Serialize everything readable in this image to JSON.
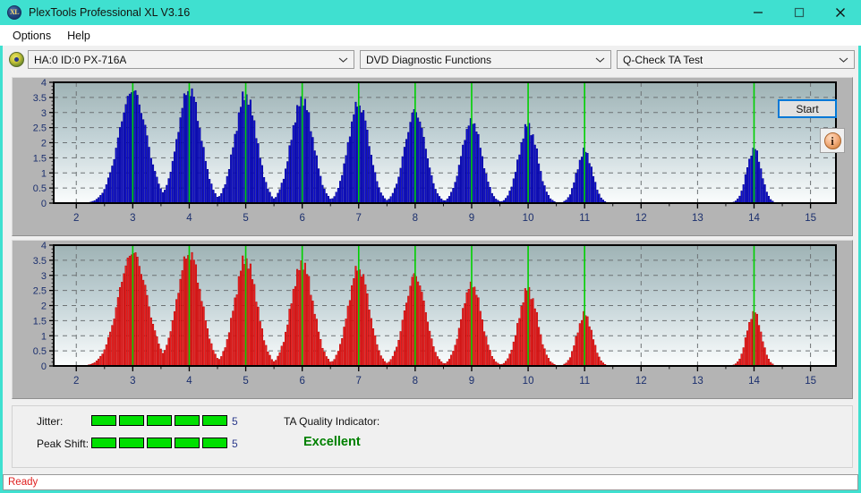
{
  "window": {
    "title": "PlexTools Professional XL V3.16",
    "icon_label": "XL",
    "icon_name": "plextools-logo-icon",
    "accent_color": "#3fe0d0",
    "controls": {
      "minimize": "minimize-icon",
      "maximize": "maximize-icon",
      "close": "close-icon"
    }
  },
  "menubar": {
    "items": [
      {
        "label": "Options"
      },
      {
        "label": "Help"
      }
    ]
  },
  "toolbar": {
    "drive_icon": "disc-icon",
    "drive_select": {
      "value": "HA:0 ID:0  PX-716A",
      "options": [
        "HA:0 ID:0  PX-716A"
      ]
    },
    "function_select": {
      "value": "DVD Diagnostic Functions",
      "options": [
        "DVD Diagnostic Functions"
      ]
    },
    "test_select": {
      "value": "Q-Check TA Test",
      "options": [
        "Q-Check TA Test"
      ]
    }
  },
  "results": {
    "jitter_label": "Jitter:",
    "jitter_value": "5",
    "jitter_blocks_on": 5,
    "jitter_blocks_total": 5,
    "peak_shift_label": "Peak Shift:",
    "peak_shift_value": "5",
    "peak_shift_blocks_on": 5,
    "peak_shift_blocks_total": 5,
    "ta_quality_label": "TA Quality Indicator:",
    "ta_quality_value": "Excellent",
    "ta_quality_color": "#008000",
    "block_color": "#00e000",
    "start_label": "Start",
    "info_label": "i"
  },
  "statusbar": {
    "text": "Ready",
    "color": "#e02020"
  },
  "chart_data": [
    {
      "id": "jitter-chart",
      "type": "bar",
      "title": "",
      "xlabel": "",
      "ylabel": "",
      "series_name": "Jitter",
      "bar_color": "#0d0dd6",
      "bar_edge_color": "#000080",
      "marker_color": "#00d000",
      "grid": true,
      "xlim": [
        1.6,
        15.45
      ],
      "ylim": [
        0,
        4
      ],
      "xticks": [
        2,
        3,
        4,
        5,
        6,
        7,
        8,
        9,
        10,
        11,
        12,
        13,
        14,
        15
      ],
      "yticks": [
        0,
        0.5,
        1,
        1.5,
        2,
        2.5,
        3,
        3.5,
        4
      ],
      "ytick_labels": [
        "0",
        "0.5",
        "1",
        "1.5",
        "2",
        "2.5",
        "3",
        "3.5",
        "4"
      ],
      "markers": [
        3,
        4,
        5,
        6,
        7,
        8,
        9,
        10,
        11,
        14
      ],
      "clusters": [
        {
          "center": 3.0,
          "peak": 3.72,
          "half_width": 0.5
        },
        {
          "center": 4.0,
          "peak": 3.76,
          "half_width": 0.42
        },
        {
          "center": 5.0,
          "peak": 3.56,
          "half_width": 0.4
        },
        {
          "center": 6.0,
          "peak": 3.42,
          "half_width": 0.4
        },
        {
          "center": 7.0,
          "peak": 3.28,
          "half_width": 0.38
        },
        {
          "center": 8.0,
          "peak": 3.02,
          "half_width": 0.38
        },
        {
          "center": 9.0,
          "peak": 2.72,
          "half_width": 0.36
        },
        {
          "center": 10.0,
          "peak": 2.56,
          "half_width": 0.34
        },
        {
          "center": 11.0,
          "peak": 1.72,
          "half_width": 0.28
        },
        {
          "center": 14.0,
          "peak": 1.8,
          "half_width": 0.26
        }
      ]
    },
    {
      "id": "peak-shift-chart",
      "type": "bar",
      "title": "",
      "xlabel": "",
      "ylabel": "",
      "series_name": "Peak Shift",
      "bar_color": "#f02020",
      "bar_edge_color": "#b00000",
      "marker_color": "#00d000",
      "grid": true,
      "xlim": [
        1.6,
        15.45
      ],
      "ylim": [
        0,
        4
      ],
      "xticks": [
        2,
        3,
        4,
        5,
        6,
        7,
        8,
        9,
        10,
        11,
        12,
        13,
        14,
        15
      ],
      "yticks": [
        0,
        0.5,
        1,
        1.5,
        2,
        2.5,
        3,
        3.5,
        4
      ],
      "ytick_labels": [
        "0",
        "0.5",
        "1",
        "1.5",
        "2",
        "2.5",
        "3",
        "3.5",
        "4"
      ],
      "markers": [
        3,
        4,
        5,
        6,
        7,
        8,
        9,
        10,
        11,
        14
      ],
      "clusters": [
        {
          "center": 3.0,
          "peak": 3.74,
          "half_width": 0.52
        },
        {
          "center": 4.0,
          "peak": 3.72,
          "half_width": 0.44
        },
        {
          "center": 5.0,
          "peak": 3.52,
          "half_width": 0.4
        },
        {
          "center": 6.0,
          "peak": 3.38,
          "half_width": 0.4
        },
        {
          "center": 7.0,
          "peak": 3.24,
          "half_width": 0.38
        },
        {
          "center": 8.0,
          "peak": 2.98,
          "half_width": 0.38
        },
        {
          "center": 9.0,
          "peak": 2.7,
          "half_width": 0.36
        },
        {
          "center": 10.0,
          "peak": 2.52,
          "half_width": 0.34
        },
        {
          "center": 11.0,
          "peak": 1.7,
          "half_width": 0.28
        },
        {
          "center": 14.0,
          "peak": 1.78,
          "half_width": 0.26
        }
      ]
    }
  ]
}
